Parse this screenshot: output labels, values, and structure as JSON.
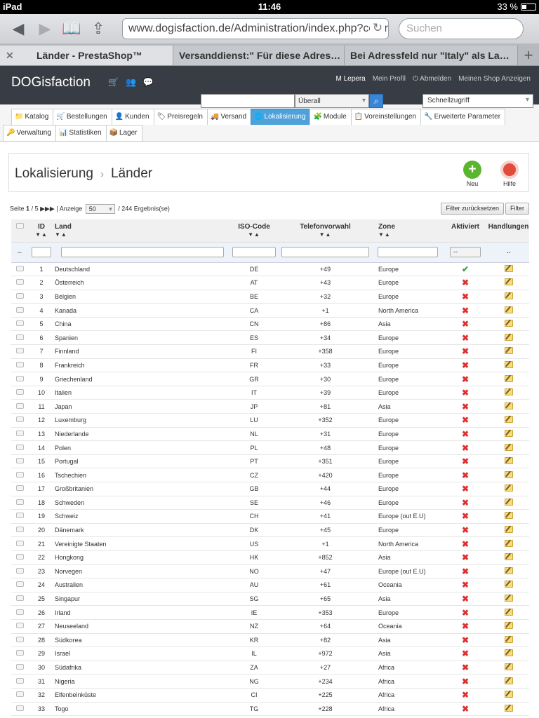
{
  "status": {
    "device": "iPad",
    "time": "11:46",
    "battery": "33 %"
  },
  "browser": {
    "url": "www.dogisfaction.de/Administration/index.php?contr",
    "search_placeholder": "Suchen",
    "tabs": [
      {
        "label": "Länder - PrestaShop™",
        "active": true
      },
      {
        "label": "Versanddienst:\" Für diese Adres…",
        "active": false
      },
      {
        "label": "Bei Adressfeld nur \"Italy\" als La…",
        "active": false
      }
    ]
  },
  "header": {
    "logo": "DOGisfaction",
    "user": "M Lepera",
    "profile": "Mein Profil",
    "logout": "Abmelden",
    "shop": "Meinen Shop Anzeigen",
    "search_scope": "Überall",
    "quick_access": "Schnellzugriff"
  },
  "menu": {
    "row1": [
      "Katalog",
      "Bestellungen",
      "Kunden",
      "Preisregeln",
      "Versand",
      "Lokalisierung",
      "Module",
      "Voreinstellungen",
      "Erweiterte Parameter"
    ],
    "row2": [
      "Verwaltung",
      "Statistiken",
      "Lager"
    ],
    "active": "Lokalisierung"
  },
  "page": {
    "breadcrumb_parent": "Lokalisierung",
    "breadcrumb_current": "Länder",
    "new_label": "Neu",
    "help_label": "Hilfe"
  },
  "list": {
    "page_text": "Seite",
    "page_current": "1",
    "page_total": "/ 5",
    "show_label": "| Anzeige",
    "per_page": "50",
    "results": "/ 244 Ergebnis(se)",
    "reset_filter": "Filter zurücksetzen",
    "filter": "Filter",
    "columns": [
      "ID",
      "Land",
      "ISO-Code",
      "Telefonvorwahl",
      "Zone",
      "Aktiviert",
      "Handlungen"
    ],
    "filter_select": "--",
    "filter_dash": "--"
  },
  "rows": [
    [
      "1",
      "Deutschland",
      "DE",
      "+49",
      "Europe",
      true
    ],
    [
      "2",
      "Österreich",
      "AT",
      "+43",
      "Europe",
      false
    ],
    [
      "3",
      "Belgien",
      "BE",
      "+32",
      "Europe",
      false
    ],
    [
      "4",
      "Kanada",
      "CA",
      "+1",
      "North America",
      false
    ],
    [
      "5",
      "China",
      "CN",
      "+86",
      "Asia",
      false
    ],
    [
      "6",
      "Spanien",
      "ES",
      "+34",
      "Europe",
      false
    ],
    [
      "7",
      "Finnland",
      "FI",
      "+358",
      "Europe",
      false
    ],
    [
      "8",
      "Frankreich",
      "FR",
      "+33",
      "Europe",
      false
    ],
    [
      "9",
      "Griechenland",
      "GR",
      "+30",
      "Europe",
      false
    ],
    [
      "10",
      "Italien",
      "IT",
      "+39",
      "Europe",
      false
    ],
    [
      "11",
      "Japan",
      "JP",
      "+81",
      "Asia",
      false
    ],
    [
      "12",
      "Luxemburg",
      "LU",
      "+352",
      "Europe",
      false
    ],
    [
      "13",
      "Niederlande",
      "NL",
      "+31",
      "Europe",
      false
    ],
    [
      "14",
      "Polen",
      "PL",
      "+48",
      "Europe",
      false
    ],
    [
      "15",
      "Portugal",
      "PT",
      "+351",
      "Europe",
      false
    ],
    [
      "16",
      "Tschechien",
      "CZ",
      "+420",
      "Europe",
      false
    ],
    [
      "17",
      "Großbritanien",
      "GB",
      "+44",
      "Europe",
      false
    ],
    [
      "18",
      "Schweden",
      "SE",
      "+46",
      "Europe",
      false
    ],
    [
      "19",
      "Schweiz",
      "CH",
      "+41",
      "Europe (out E.U)",
      false
    ],
    [
      "20",
      "Dänemark",
      "DK",
      "+45",
      "Europe",
      false
    ],
    [
      "21",
      "Vereinigte Staaten",
      "US",
      "+1",
      "North America",
      false
    ],
    [
      "22",
      "Hongkong",
      "HK",
      "+852",
      "Asia",
      false
    ],
    [
      "23",
      "Norvegen",
      "NO",
      "+47",
      "Europe (out E.U)",
      false
    ],
    [
      "24",
      "Australien",
      "AU",
      "+61",
      "Oceania",
      false
    ],
    [
      "25",
      "Singapur",
      "SG",
      "+65",
      "Asia",
      false
    ],
    [
      "26",
      "Irland",
      "IE",
      "+353",
      "Europe",
      false
    ],
    [
      "27",
      "Neuseeland",
      "NZ",
      "+64",
      "Oceania",
      false
    ],
    [
      "28",
      "Südkorea",
      "KR",
      "+82",
      "Asia",
      false
    ],
    [
      "29",
      "Israel",
      "IL",
      "+972",
      "Asia",
      false
    ],
    [
      "30",
      "Südafrika",
      "ZA",
      "+27",
      "Africa",
      false
    ],
    [
      "31",
      "Nigeria",
      "NG",
      "+234",
      "Africa",
      false
    ],
    [
      "32",
      "Elfenbeinküste",
      "CI",
      "+225",
      "Africa",
      false
    ],
    [
      "33",
      "Togo",
      "TG",
      "+228",
      "Africa",
      false
    ]
  ]
}
